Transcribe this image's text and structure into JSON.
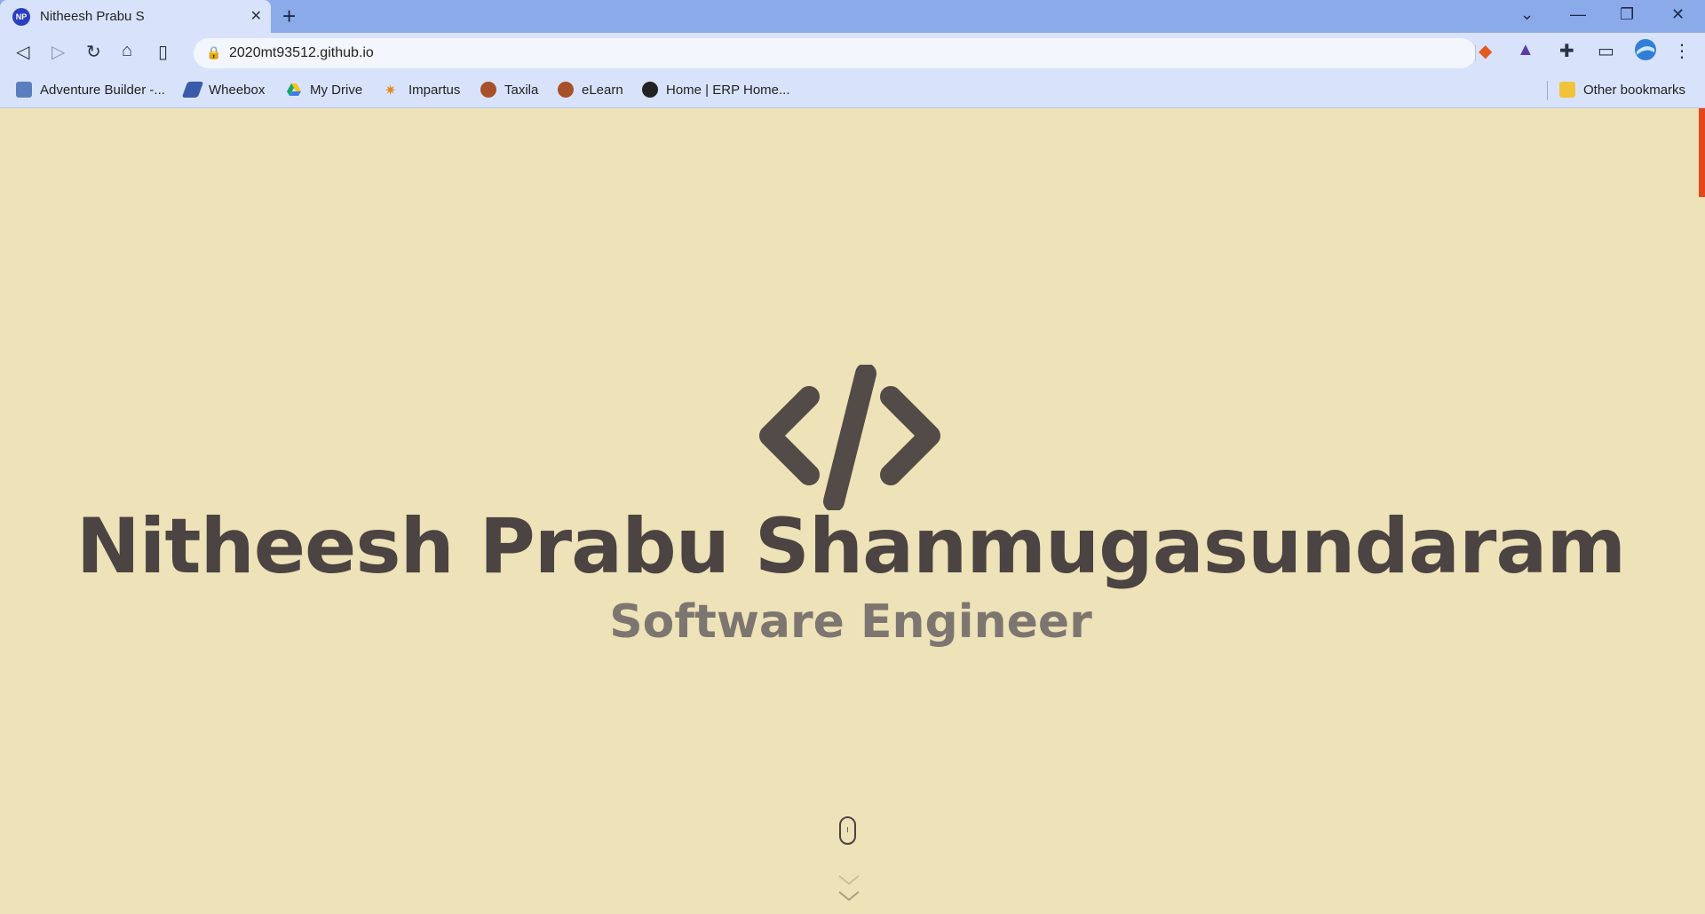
{
  "browser": {
    "tab": {
      "favicon_text": "NP",
      "title": "Nitheesh Prabu S"
    },
    "address": "2020mt93512.github.io",
    "bookmarks": [
      {
        "label": "Adventure Builder -...",
        "icon": "adventure-builder-icon"
      },
      {
        "label": "Wheebox",
        "icon": "wheebox-icon"
      },
      {
        "label": "My Drive",
        "icon": "google-drive-icon"
      },
      {
        "label": "Impartus",
        "icon": "impartus-icon"
      },
      {
        "label": "Taxila",
        "icon": "taxila-icon"
      },
      {
        "label": "eLearn",
        "icon": "elearn-icon"
      },
      {
        "label": "Home | ERP Home...",
        "icon": "globe-icon"
      }
    ],
    "other_bookmarks": "Other bookmarks"
  },
  "hero": {
    "logo_icon": "code-brackets-icon",
    "name": "Nitheesh Prabu Shanmugasundaram",
    "role": "Software Engineer"
  },
  "colors": {
    "page_background": "#ede2b8",
    "text_dark": "#4b4442",
    "text_muted": "#7d7670",
    "accent": "#e2481c"
  }
}
